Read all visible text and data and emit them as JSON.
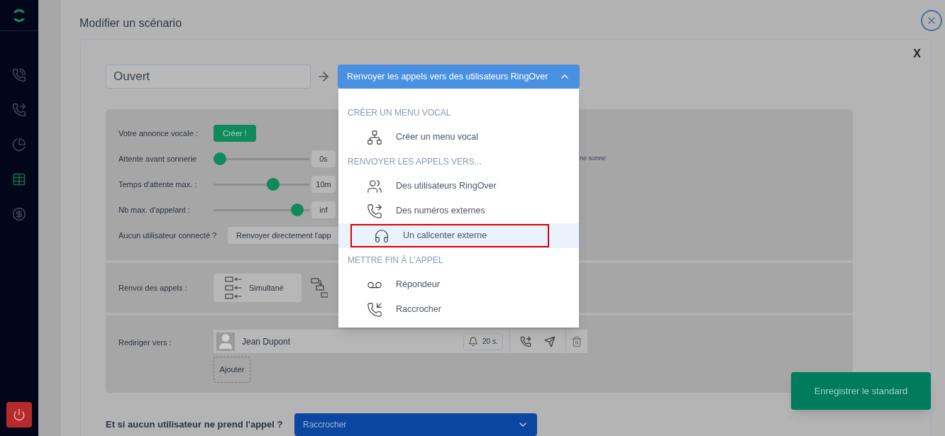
{
  "sidebar": {
    "items": [
      {
        "selected": false
      },
      {
        "selected": false
      },
      {
        "selected": false
      },
      {
        "selected": true
      },
      {
        "selected": false
      }
    ]
  },
  "page": {
    "title": "Modifier un scénario",
    "close_label": "X"
  },
  "scenario": {
    "name": "Ouvert",
    "action": "Renvoyer les appels vers des utilisateurs RingOver",
    "expanded": true
  },
  "menu": {
    "sections": [
      {
        "heading": "CRÉER UN MENU VOCAL",
        "items": [
          {
            "label": "Créer un menu vocal",
            "selected": false,
            "annotated": false
          }
        ]
      },
      {
        "heading": "RENVOYER LES APPELS VERS...",
        "items": [
          {
            "label": "Des utilisateurs RingOver",
            "selected": false,
            "annotated": false
          },
          {
            "label": "Des numéros externes",
            "selected": false,
            "annotated": false
          },
          {
            "label": "Un callcenter externe",
            "selected": true,
            "annotated": true
          }
        ]
      },
      {
        "heading": "METTRE FIN À L'APPEL",
        "items": [
          {
            "label": "Répondeur",
            "selected": false,
            "annotated": false
          },
          {
            "label": "Raccrocher",
            "selected": false,
            "annotated": false
          }
        ]
      }
    ]
  },
  "settings": {
    "announcement": {
      "label": "Votre annonce vocale :",
      "button": "Créer !"
    },
    "sliders": [
      {
        "label": "Attente avant sonnerie",
        "level": 0,
        "value": "0s"
      },
      {
        "label": "Temps d'attente max. :",
        "level": 0.64,
        "value": "10m"
      },
      {
        "label": "Nb max. d'appelant :",
        "level": 0.93,
        "value": "inf"
      }
    ],
    "hint": "ne sonne",
    "no_user": {
      "label": "Aucun utilisateur connecté ?",
      "button": "Renvoyer directement l'app"
    }
  },
  "forwarding": {
    "label": "Renvoi des appels :",
    "mode": "Simultané"
  },
  "redirect": {
    "label": "Rediriger vers :",
    "users": [
      {
        "name": "Jean Dupont",
        "delay": "20 s."
      }
    ],
    "add_button": "Ajouter"
  },
  "fallback": {
    "question": "Et si aucun utilisateur ne prend l'appel ?",
    "value": "Raccrocher"
  },
  "save_button": "Enregistrer le standard"
}
